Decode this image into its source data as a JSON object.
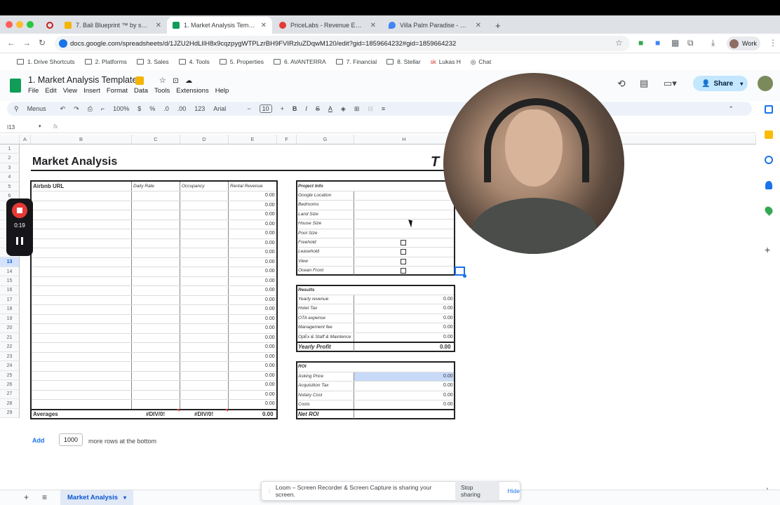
{
  "browser": {
    "tabs": [
      {
        "label": "7. Bali Blueprint ™ by shape.l",
        "color": "#f4b400"
      },
      {
        "label": "1. Market Analysis Templa",
        "color": "#0f9d58"
      },
      {
        "label": "PriceLabs - Revenue Estimat",
        "color": "#e53935"
      },
      {
        "label": "Villa Palm Paradise - Google",
        "color": "#4285f4"
      }
    ],
    "url": "docs.google.com/spreadsheets/d/1JZU2HdLlIH8x9cqzpygWTPLzrBH9FVIRzluZDqwM120/edit?gid=1859664232#gid=1859664232",
    "profile": "Work",
    "bookmarks": [
      "1. Drive Shortcuts",
      "2. Platforms",
      "3. Sales",
      "4. Tools",
      "5. Properties",
      "6. AVANTERRA",
      "7. Financial",
      "8. Stellar",
      "Lukas H",
      "Chat"
    ]
  },
  "sheet": {
    "title": "1. Market Analysis Template",
    "menus": [
      "File",
      "Edit",
      "View",
      "Insert",
      "Format",
      "Data",
      "Tools",
      "Extensions",
      "Help"
    ],
    "share_label": "Share",
    "toolbar": {
      "menus": "Menus",
      "zoom": "100%",
      "currency": "$",
      "percent": "%",
      "dec_less": ".0",
      "dec_more": ".00",
      "number_format": "123",
      "font": "Arial",
      "font_size": "10"
    },
    "name_box": "I13",
    "fx": "fx",
    "columns": [
      "A",
      "B",
      "C",
      "D",
      "E",
      "F",
      "G",
      "H"
    ],
    "rows": [
      "1",
      "2",
      "3",
      "4",
      "5",
      "6",
      "7",
      "8",
      "9",
      "10",
      "11",
      "12",
      "13",
      "14",
      "15",
      "16",
      "17",
      "18",
      "19",
      "20",
      "21",
      "22",
      "23",
      "24",
      "25",
      "26",
      "27",
      "28",
      "29"
    ],
    "selected_row": "13"
  },
  "content": {
    "heading": "Market Analysis",
    "heading_right": "T",
    "airbnb": {
      "headers": [
        "Airbnb URL",
        "Daily Rate",
        "Occupancy",
        "Rental Revenue"
      ],
      "revenue_values": [
        "0.00",
        "0.00",
        "0.00",
        "0.00",
        "0.00",
        "0.00",
        "0.00",
        "0.00",
        "0.00",
        "0.00",
        "0.00",
        "0.00",
        "0.00",
        "0.00",
        "0.00",
        "0.00",
        "0.00",
        "0.00",
        "0.00",
        "0.00",
        "0.00",
        "0.00",
        "0.00"
      ],
      "averages_label": "Averages",
      "avg_daily": "#DIV/0!",
      "avg_occupancy": "#DIV/0!",
      "avg_revenue": "0.00"
    },
    "project_info": {
      "header": "Project Info",
      "fields": [
        "Google Location",
        "Bedrooms",
        "Land Size",
        "House Size",
        "Pool Size",
        "Freehold",
        "Leasehold",
        "View",
        "Ocean Front"
      ]
    },
    "results": {
      "header": "Results",
      "rows": [
        {
          "label": "Yearly revenue",
          "value": "0.00"
        },
        {
          "label": "Hotel Tax",
          "value": "0.00"
        },
        {
          "label": "OTA expense",
          "value": "0.00"
        },
        {
          "label": "Management fee",
          "value": "0.00"
        },
        {
          "label": "OpEx & Staff & Maintence",
          "value": "0.00"
        }
      ],
      "profit_label": "Yearly Profit",
      "profit_value": "0.00"
    },
    "roi": {
      "header": "ROI",
      "rows": [
        {
          "label": "Asking Price",
          "value": "0.00"
        },
        {
          "label": "Acquisition Tax",
          "value": "0.00"
        },
        {
          "label": "Notary Cost",
          "value": "0.00"
        },
        {
          "label": "Costs",
          "value": "0.00"
        }
      ],
      "net_label": "Net ROI"
    },
    "add_rows": {
      "button": "Add",
      "count": "1000",
      "suffix": "more rows at the bottom"
    }
  },
  "recorder": {
    "time": "0:19"
  },
  "footer": {
    "sheet_tab": "Market Analysis",
    "loom_text": "Loom – Screen Recorder & Screen Capture is sharing your screen.",
    "stop_sharing": "Stop sharing",
    "hide": "Hide"
  }
}
